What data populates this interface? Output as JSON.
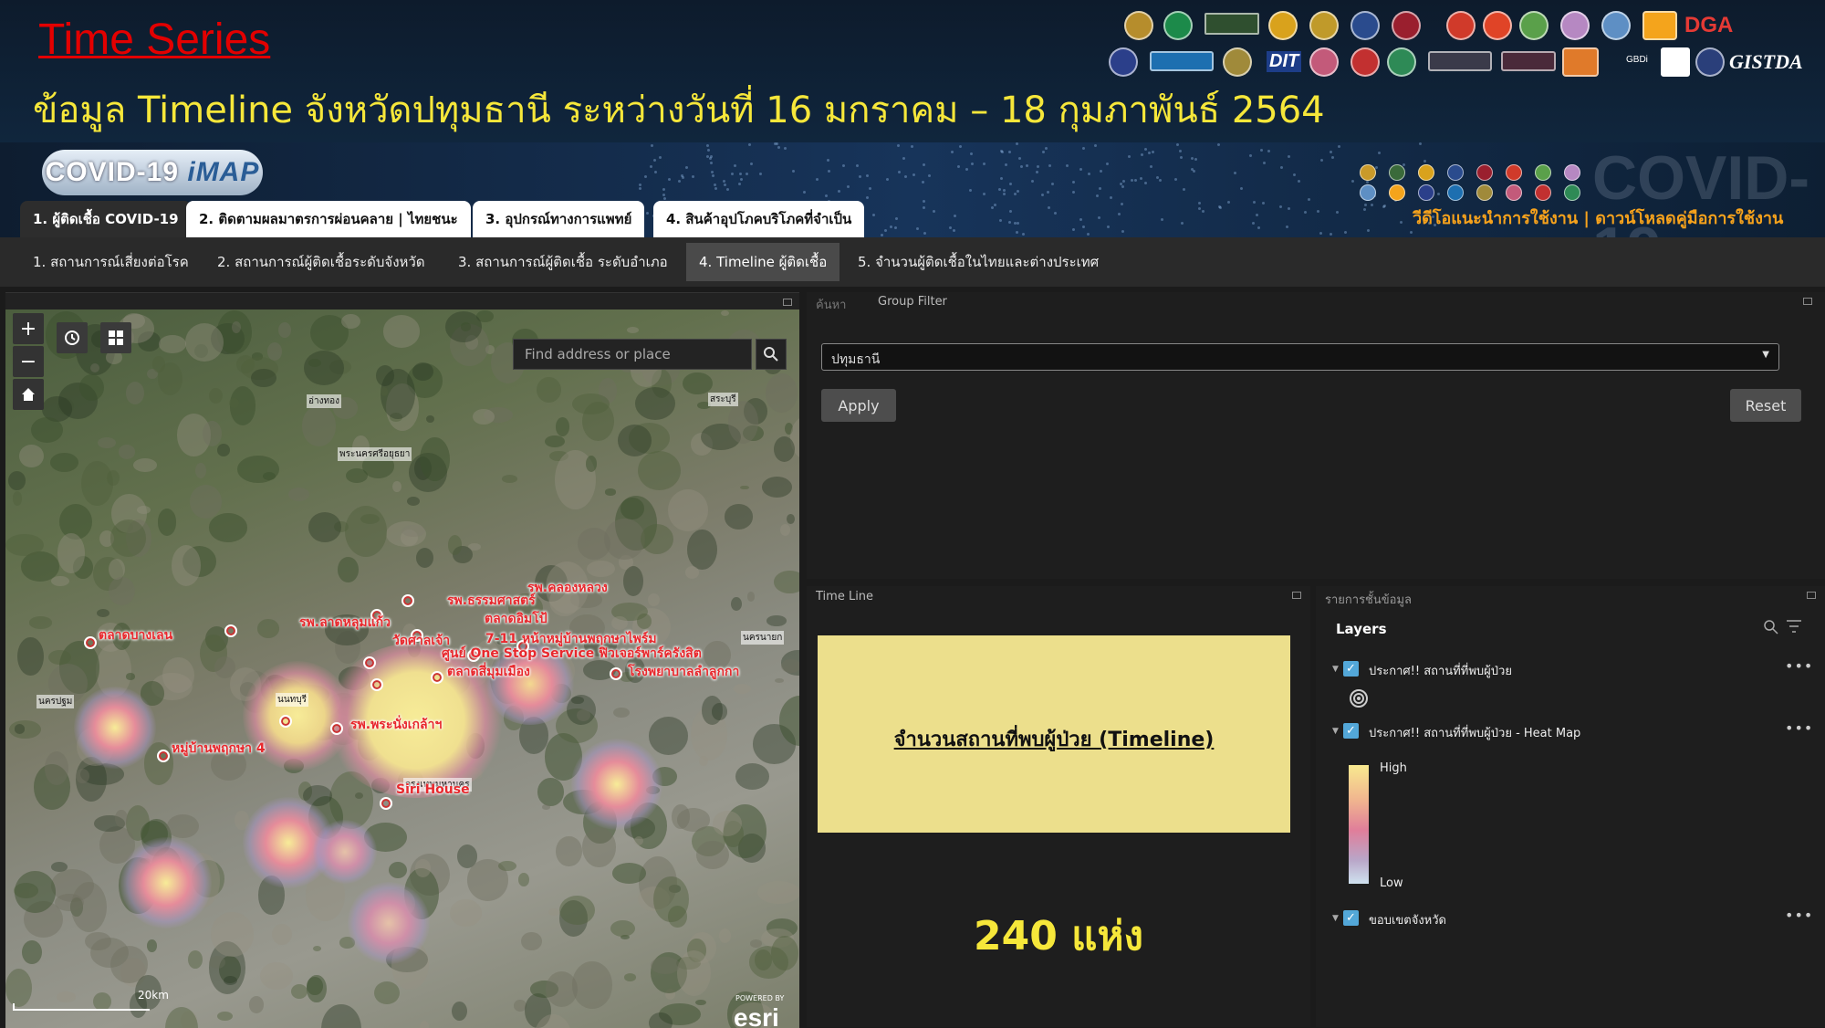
{
  "slide": {
    "title": "Time Series",
    "subtitle": "ข้อมูล Timeline จังหวัดปทุมธานี ระหว่างวันที่ 16 มกราคม – 18 กุมภาพันธ์ 2564",
    "title_color": "#e30000",
    "subtitle_color": "#f6e73a"
  },
  "logos": {
    "dga": "DGA",
    "gistda": "GISTDA",
    "dit": "DIT",
    "gbdi": "GBDi"
  },
  "app": {
    "logo_prefix": "COVID-19",
    "logo_suffix": "iMAP",
    "watermark": "COVID-19",
    "help_links": "วีดีโอแนะนำการใช้งาน | ดาวน์โหลดคู่มือการใช้งาน"
  },
  "main_tabs": [
    {
      "label": "1. ผู้ติดเชื้อ COVID-19"
    },
    {
      "label": "2. ติดตามผลมาตรการผ่อนคลาย | ไทยชนะ"
    },
    {
      "label": "3. อุปกรณ์ทางการแพทย์"
    },
    {
      "label": "4. สินค้าอุปโภคบริโภคที่จำเป็น"
    }
  ],
  "sub_tabs": [
    {
      "label": "1. สถานการณ์เสี่ยงต่อโรค"
    },
    {
      "label": "2. สถานการณ์ผู้ติดเชื้อระดับจังหวัด"
    },
    {
      "label": "3. สถานการณ์ผู้ติดเชื้อ ระดับอำเภอ"
    },
    {
      "label": "4. Timeline ผู้ติดเชื้อ"
    },
    {
      "label": "5. จำนวนผู้ติดเชื้อในไทยและต่างประเทศ"
    }
  ],
  "map": {
    "search_placeholder": "Find address or place",
    "scale_label": "20km",
    "esri": "esri",
    "powered_by": "POWERED BY",
    "places": [
      "อ่างทอง",
      "สระบุรี",
      "พระนครศรีอยุธยา",
      "นครนายก",
      "นครปฐม",
      "นนทบุรี",
      "กรุงเทพมหานคร"
    ],
    "hotspots": [
      "รพ.คลองหลวง",
      "รพ.ธรรมศาสตร์",
      "ตลาดอิมโป้",
      "รพ.ลาดหลุมแก้ว",
      "ตลาดบางเลน",
      "วัดศาลเจ้า",
      "7-11 หน้าหมู่บ้านพฤกษาไพร์ม",
      "ศูนย์ One Stop Service ฟิวเจอร์พาร์ครังสิต",
      "ตลาดสี่มุมเมือง",
      "โรงพยาบาลลำลูกกา",
      "รพ.พระนั่งเกล้าฯ",
      "หมู่บ้านพฤกษา 4",
      "Siri House"
    ]
  },
  "filter": {
    "tab_search": "ค้นหา",
    "tab_group": "Group Filter",
    "province": "ปทุมธานี",
    "apply": "Apply",
    "reset": "Reset"
  },
  "timeline": {
    "panel_title": "Time Line",
    "heading": "จำนวนสถานที่พบผู้ป่วย (Timeline)",
    "count": "240  แห่ง"
  },
  "layers": {
    "panel_title": "รายการชั้นข้อมูล",
    "header": "Layers",
    "items": [
      {
        "label": "ประกาศ!! สถานที่ที่พบผู้ป่วย"
      },
      {
        "label": "ประกาศ!! สถานที่ที่พบผู้ป่วย - Heat Map"
      },
      {
        "label": "ขอบเขตจังหวัด"
      }
    ],
    "legend_high": "High",
    "legend_low": "Low"
  }
}
